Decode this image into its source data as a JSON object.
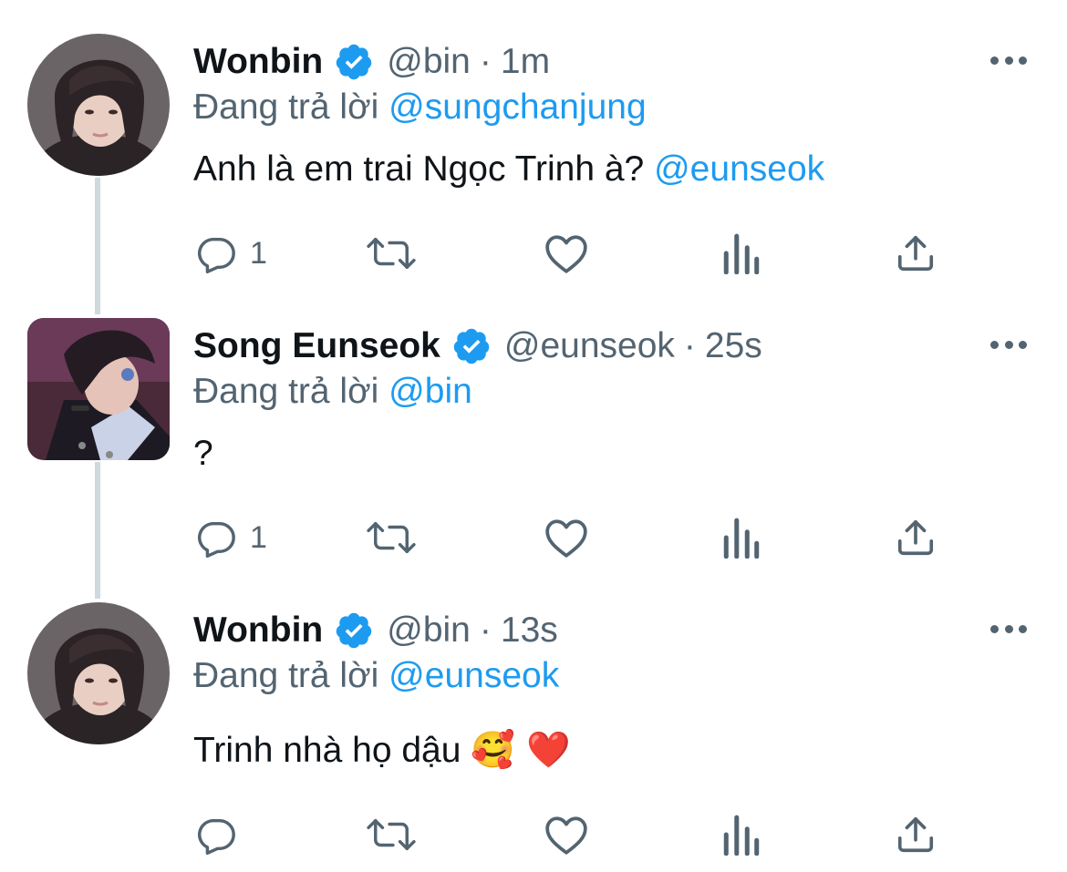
{
  "colors": {
    "mention": "#1d9bf0",
    "verified": "#1d9bf0",
    "secondary_text": "#536471",
    "primary_text": "#0f1419",
    "thread_line": "#cfd9de"
  },
  "tweets": [
    {
      "display_name": "Wonbin",
      "verified": true,
      "handle": "@bin",
      "separator": "·",
      "time": "1m",
      "reply_prefix": "Đang trả lời",
      "reply_to": "@sungchanjung",
      "text": "Anh là em trai Ngọc Trinh à?",
      "text_mention": "@eunseok",
      "reply_count": "1",
      "avatar_icon": "avatar-wonbin"
    },
    {
      "display_name": "Song Eunseok",
      "verified": true,
      "handle": "@eunseok",
      "separator": "·",
      "time": "25s",
      "reply_prefix": "Đang trả lời",
      "reply_to": "@bin",
      "text": "?",
      "reply_count": "1",
      "avatar_icon": "avatar-eunseok"
    },
    {
      "display_name": "Wonbin",
      "verified": true,
      "handle": "@bin",
      "separator": "·",
      "time": "13s",
      "reply_prefix": "Đang trả lời",
      "reply_to": "@eunseok",
      "text": "Trinh nhà họ dậu",
      "emojis": "🥰 ❤️",
      "reply_count": "",
      "avatar_icon": "avatar-wonbin"
    }
  ],
  "icons": {
    "reply": "reply-icon",
    "retweet": "retweet-icon",
    "like": "heart-icon",
    "analytics": "analytics-icon",
    "share": "share-icon",
    "more": "more-icon",
    "verified": "verified-badge-icon"
  }
}
